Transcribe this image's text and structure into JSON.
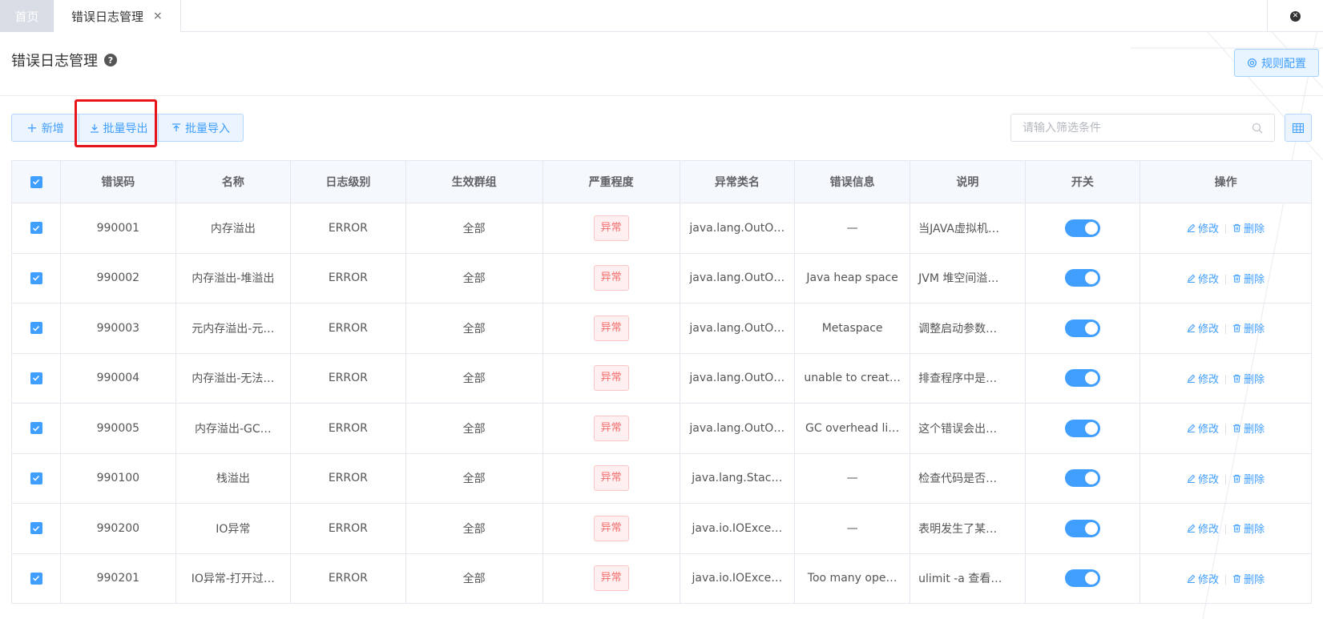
{
  "tabs": {
    "home": "首页",
    "active": "错误日志管理",
    "close_symbol": "×"
  },
  "header": {
    "title": "错误日志管理",
    "help_symbol": "?",
    "rules_button": "规则配置"
  },
  "toolbar": {
    "add": "新增",
    "export": "批量导出",
    "import": "批量导入"
  },
  "search": {
    "placeholder": "请输入筛选条件"
  },
  "table": {
    "headers": [
      "错误码",
      "名称",
      "日志级别",
      "生效群组",
      "严重程度",
      "异常类名",
      "错误信息",
      "说明",
      "开关",
      "操作"
    ],
    "edit_label": "修改",
    "delete_label": "删除",
    "rows": [
      {
        "code": "990001",
        "name": "内存溢出",
        "level": "ERROR",
        "group": "全部",
        "severity": "异常",
        "cls": "java.lang.OutO…",
        "msg": "—",
        "desc": "当JAVA虚拟机…",
        "on": true
      },
      {
        "code": "990002",
        "name": "内存溢出-堆溢出",
        "level": "ERROR",
        "group": "全部",
        "severity": "异常",
        "cls": "java.lang.OutO…",
        "msg": "Java heap space",
        "desc": "JVM 堆空间溢…",
        "on": true
      },
      {
        "code": "990003",
        "name": "元内存溢出-元…",
        "level": "ERROR",
        "group": "全部",
        "severity": "异常",
        "cls": "java.lang.OutO…",
        "msg": "Metaspace",
        "desc": "调整启动参数…",
        "on": true
      },
      {
        "code": "990004",
        "name": "内存溢出-无法…",
        "level": "ERROR",
        "group": "全部",
        "severity": "异常",
        "cls": "java.lang.OutO…",
        "msg": "unable to creat…",
        "desc": "排查程序中是…",
        "on": true
      },
      {
        "code": "990005",
        "name": "内存溢出-GC…",
        "level": "ERROR",
        "group": "全部",
        "severity": "异常",
        "cls": "java.lang.OutO…",
        "msg": "GC overhead li…",
        "desc": "这个错误会出…",
        "on": true
      },
      {
        "code": "990100",
        "name": "栈溢出",
        "level": "ERROR",
        "group": "全部",
        "severity": "异常",
        "cls": "java.lang.Stac…",
        "msg": "—",
        "desc": "检查代码是否…",
        "on": true
      },
      {
        "code": "990200",
        "name": "IO异常",
        "level": "ERROR",
        "group": "全部",
        "severity": "异常",
        "cls": "java.io.IOExce…",
        "msg": "—",
        "desc": "表明发生了某…",
        "on": true
      },
      {
        "code": "990201",
        "name": "IO异常-打开过…",
        "level": "ERROR",
        "group": "全部",
        "severity": "异常",
        "cls": "java.io.IOExce…",
        "msg": "Too many ope…",
        "desc": "ulimit -a 查看…",
        "on": true
      }
    ]
  },
  "colors": {
    "primary": "#409eff",
    "danger": "#f56c6c",
    "highlight": "#e8141b"
  }
}
